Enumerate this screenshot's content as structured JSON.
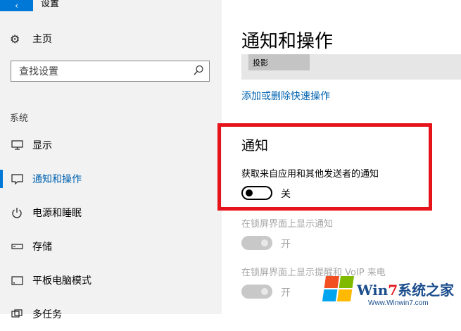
{
  "titlebar": {
    "back_icon": "‹",
    "title": "设置"
  },
  "sidebar": {
    "home_label": "主页",
    "search_placeholder": "查找设置",
    "section_label": "系统",
    "items": [
      {
        "label": "显示",
        "icon": "monitor-icon"
      },
      {
        "label": "通知和操作",
        "icon": "notification-icon",
        "active": true
      },
      {
        "label": "电源和睡眠",
        "icon": "power-icon"
      },
      {
        "label": "存储",
        "icon": "storage-icon"
      },
      {
        "label": "平板电脑模式",
        "icon": "tablet-icon"
      },
      {
        "label": "多任务",
        "icon": "multitask-icon"
      }
    ]
  },
  "main": {
    "page_title": "通知和操作",
    "quick_action_tile": "投影",
    "add_remove_link": "添加或删除快速操作",
    "notifications": {
      "heading": "通知",
      "get_notifications_label": "获取来自应用和其他发送者的通知",
      "get_notifications_state": "关",
      "lockscreen_label": "在锁屏界面上显示通知",
      "lockscreen_state": "开",
      "reminders_label": "在锁屏界面上显示提醒和 VoIP 来电",
      "reminders_state": "开"
    }
  },
  "watermark": {
    "brand_prefix": "Win",
    "brand_number": "7",
    "brand_suffix": "系统之家",
    "url": "Www.Winwin7.com"
  },
  "colors": {
    "accent": "#0078d7",
    "link": "#0063b1",
    "highlight_box": "#e6131b",
    "sidebar_bg": "#f2f2f2"
  }
}
